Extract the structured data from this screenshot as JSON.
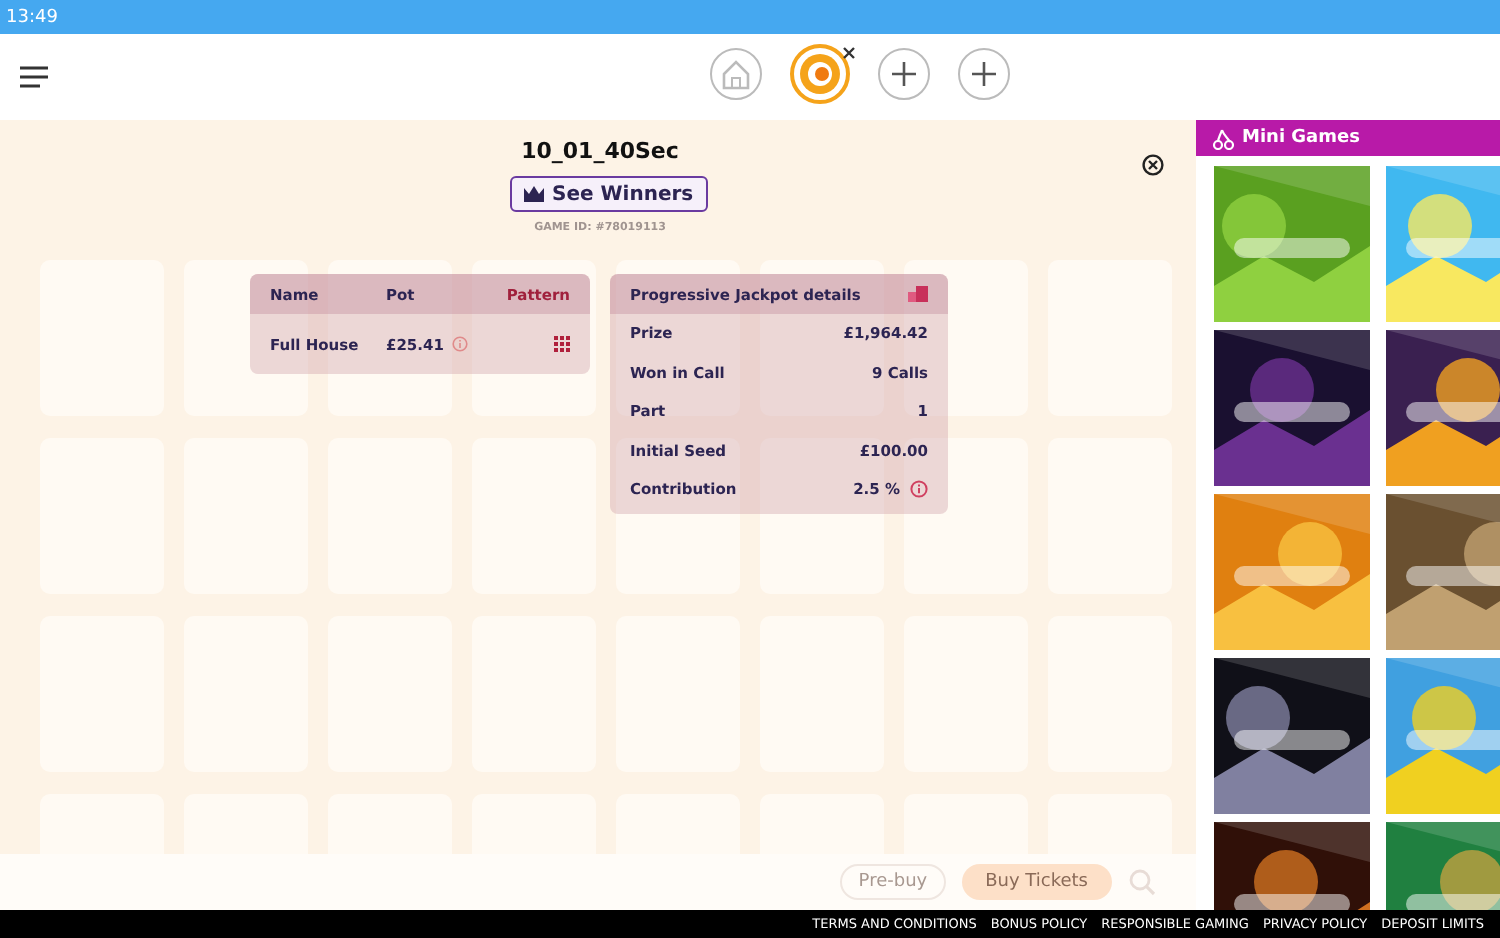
{
  "status_bar": {
    "time": "13:49"
  },
  "header": {
    "tabs": [
      {
        "kind": "home",
        "selected": false
      },
      {
        "kind": "game",
        "selected": true
      },
      {
        "kind": "add",
        "selected": false
      },
      {
        "kind": "add",
        "selected": false
      }
    ]
  },
  "game": {
    "title": "10_01_40Sec",
    "see_winners": "See Winners",
    "game_id": "GAME ID: #78019113",
    "patterns": {
      "columns": [
        "Name",
        "Pot",
        "Pattern"
      ],
      "rows": [
        {
          "name": "Full House",
          "pot": "£25.41"
        }
      ]
    },
    "jackpot": {
      "title": "Progressive Jackpot details",
      "rows": [
        {
          "label": "Prize",
          "value": "£1,964.42",
          "info": false
        },
        {
          "label": "Won in Call",
          "value": "9 Calls",
          "info": false
        },
        {
          "label": "Part",
          "value": "1",
          "info": false
        },
        {
          "label": "Initial Seed",
          "value": "£100.00",
          "info": false
        },
        {
          "label": "Contribution",
          "value": "2.5 %",
          "info": true
        }
      ]
    },
    "actions": [
      "Pre-buy",
      "Buy Tickets"
    ]
  },
  "mini_games": {
    "title": "Mini Games"
  },
  "footer": [
    "TERMS AND CONDITIONS",
    "BONUS POLICY",
    "RESPONSIBLE GAMING",
    "PRIVACY POLICY",
    "DEPOSIT LIMITS"
  ]
}
